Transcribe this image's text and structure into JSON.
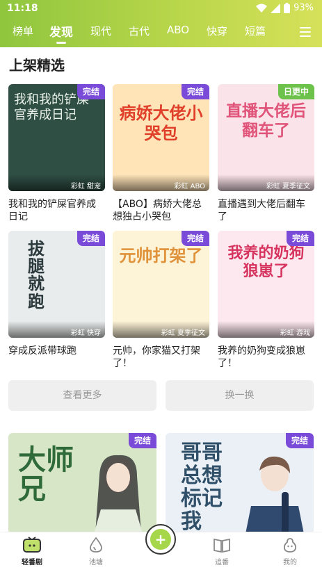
{
  "status_bar": {
    "time": "11:18",
    "battery": "93%"
  },
  "tabs": [
    {
      "label": "榜单",
      "active": false
    },
    {
      "label": "发现",
      "active": true
    },
    {
      "label": "现代",
      "active": false
    },
    {
      "label": "古代",
      "active": false
    },
    {
      "label": "ABO",
      "active": false
    },
    {
      "label": "快穿",
      "active": false
    },
    {
      "label": "短篇",
      "active": false
    }
  ],
  "section": {
    "title": "上架精选"
  },
  "books": [
    {
      "title": "我和我的铲屎官养成日记",
      "badge": "完结",
      "tags": "彩虹 甜宠",
      "cover_text": "我和我的铲屎官养成日记",
      "cover_bg": "#2f4f45",
      "cover_fg": "#eaf2ea"
    },
    {
      "title": "【ABO】病娇大佬总想独占小哭包",
      "badge": "完结",
      "tags": "彩虹 ABO",
      "cover_text": "病娇大佬小哭包",
      "cover_bg": "#ffe4b8",
      "cover_fg": "#e0402a"
    },
    {
      "title": "直播遇到大佬后翻车了",
      "badge": "日更中",
      "tags": "彩虹 夏季征文",
      "cover_text": "直播大佬后翻车了",
      "cover_bg": "#fbe3ea",
      "cover_fg": "#e0547a"
    },
    {
      "title": "穿成反派带球跑",
      "badge": "完结",
      "tags": "彩虹 快穿",
      "cover_text": "拔腿就跑",
      "cover_bg": "#e9ecec",
      "cover_fg": "#2c3a3e"
    },
    {
      "title": "元帅，你家猫又打架了！",
      "badge": "完结",
      "tags": "彩虹 夏季征文",
      "cover_text": "元帅打架了",
      "cover_bg": "#fdf3d6",
      "cover_fg": "#e0923a"
    },
    {
      "title": "我养的奶狗变成狼崽了！",
      "badge": "完结",
      "tags": "彩虹 游戏",
      "cover_text": "我养的奶狗狼崽了",
      "cover_bg": "#fde8ef",
      "cover_fg": "#d6335f"
    }
  ],
  "buttons": {
    "more": "查看更多",
    "refresh": "换一换"
  },
  "featured": [
    {
      "badge": "完结",
      "cover_text": "大师兄",
      "cover_bg": "#d8e6c8",
      "cover_fg": "#2f6a3a"
    },
    {
      "badge": "完结",
      "cover_text": "哥哥总想标记我",
      "cover_bg": "#eaf0f6",
      "cover_fg": "#30506a"
    }
  ],
  "nav": [
    {
      "label": "轻番剧",
      "icon": "tv-icon",
      "active": true
    },
    {
      "label": "池塘",
      "icon": "water-drop-icon",
      "active": false
    },
    {
      "label": "追番",
      "icon": "book-icon",
      "active": false
    },
    {
      "label": "我的",
      "icon": "pear-face-icon",
      "active": false
    }
  ],
  "colors": {
    "header_start": "#8fc63e",
    "header_end": "#d6e15a",
    "badge_purple": "#7a4ad8",
    "badge_green": "#6cc24a"
  }
}
